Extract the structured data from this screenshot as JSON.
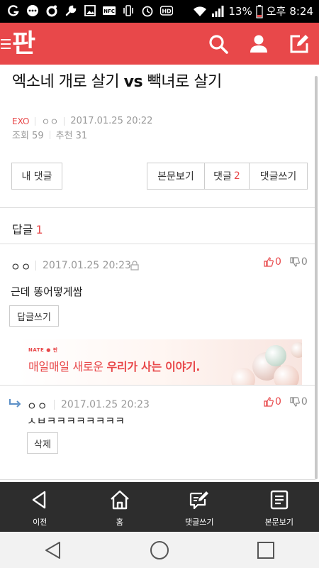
{
  "status_bar": {
    "battery": "13%",
    "period": "오후",
    "time": "8:24",
    "icons": [
      "g-icon",
      "dots-icon",
      "circle-icon",
      "wrench-icon",
      "image-icon",
      "nfc-icon",
      "vibrate-icon",
      "alarm-icon",
      "hd-icon",
      "wifi-icon",
      "signal-icon",
      "battery-icon"
    ]
  },
  "header": {
    "logo": "판",
    "icons": [
      "menu-icon",
      "search-icon",
      "person-icon",
      "write-icon"
    ],
    "accent": "#e8484a"
  },
  "post": {
    "title_a": "엑소네 개로 살기 ",
    "title_vs": "vs",
    "title_b": " 빽녀로 살기",
    "category": "EXO",
    "author": "ㅇㅇ",
    "datetime": "2017.01.25 20:22",
    "views": "조회 59",
    "recommends": "추천 31"
  },
  "buttons": {
    "my_comments": "내 댓글",
    "view_post": "본문보기",
    "comments": "댓글",
    "comments_count": "2",
    "write_comment": "댓글쓰기"
  },
  "replies": {
    "label": "답글",
    "count": "1"
  },
  "comment1": {
    "author": "ㅇㅇ",
    "date": "2017.01.25 20:23",
    "up": "0",
    "down": "0",
    "body": "근데 똥어떻게쌈",
    "reply_btn": "답글쓰기"
  },
  "ad": {
    "brand": "NATE ● 판",
    "text_a": "매일매일 새로운 ",
    "text_b": "우리가 사는 이야기."
  },
  "comment2": {
    "author": "ㅇㅇ",
    "date": "2017.01.25 20:23",
    "up": "0",
    "down": "0",
    "body": "ㅅㅂㅋㅋㅋㅋㅋㅋㅋㅋ",
    "delete_btn": "삭제"
  },
  "toolbar": {
    "prev": "이전",
    "home": "홈",
    "write_comment": "댓글쓰기",
    "view_post": "본문보기"
  },
  "navbar": {
    "icons": [
      "back-icon",
      "home-circle-icon",
      "recent-apps-icon"
    ]
  }
}
